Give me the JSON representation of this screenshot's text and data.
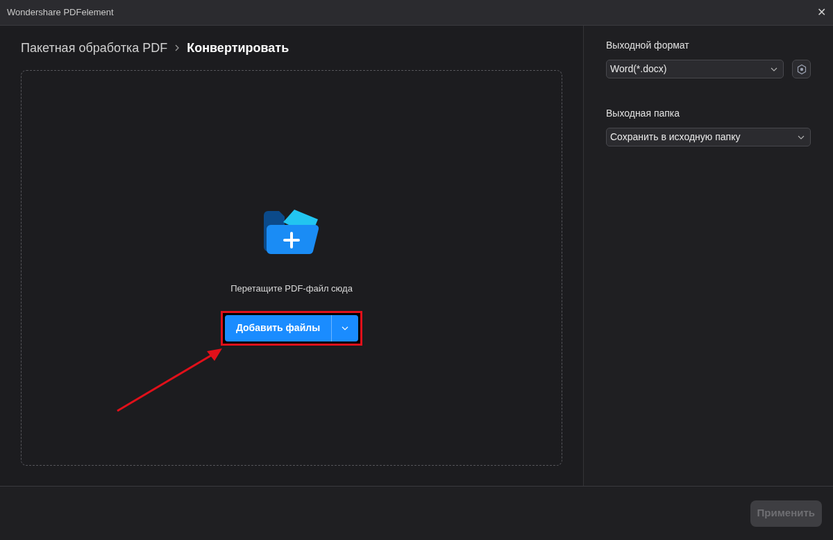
{
  "window": {
    "title": "Wondershare PDFelement",
    "close": "✕"
  },
  "breadcrumb": [
    {
      "label": "Пакетная обработка PDF",
      "current": false
    },
    {
      "label": "Конвертировать",
      "current": true
    }
  ],
  "drop_zone": {
    "hint": "Перетащите PDF-файл сюда",
    "button": "Добавить файлы",
    "highlighted": true
  },
  "settings": [
    {
      "kind": "format",
      "label": "Выходной формат",
      "value": "Word(*.docx)"
    },
    {
      "kind": "folder",
      "label": "Выходная папка",
      "value": "Сохранить в исходную папку"
    }
  ],
  "footer": {
    "button": "Применить",
    "disabled": true
  }
}
